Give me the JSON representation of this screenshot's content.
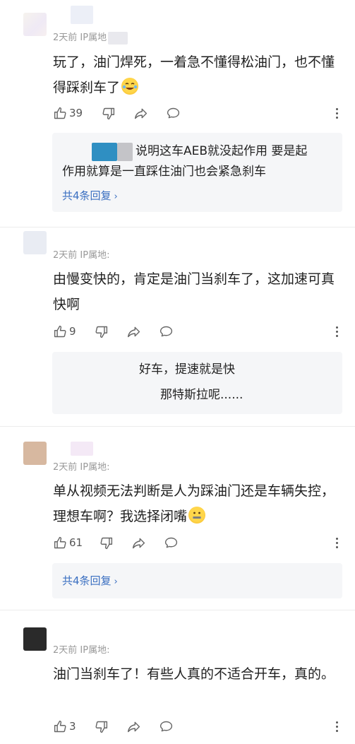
{
  "comments": [
    {
      "meta": "2天前 IP属地",
      "text": "玩了，油门焊死，一着急不懂得松油门，也不懂得踩刹车了",
      "emoji": "laughing-crying-emoji",
      "likes": "39",
      "reply": {
        "line1": "说明这车AEB就没起作用 要是起",
        "line2": "作用就算是一直踩住油门也会紧急刹车",
        "count": "共4条回复"
      }
    },
    {
      "meta": "2天前 IP属地:",
      "text": "由慢变快的，肯定是油门当刹车了，这加速可真快啊",
      "likes": "9",
      "reply": {
        "line1": "好车，提速就是快",
        "line2": "那特斯拉呢......"
      }
    },
    {
      "meta": "2天前 IP属地:",
      "text": "单从视频无法判断是人为踩油门还是车辆失控，理想车啊？我选择闭嘴",
      "emoji": "zipper-mouth-emoji",
      "likes": "61",
      "reply": {
        "count": "共4条回复"
      }
    },
    {
      "meta": "2天前 IP属地:",
      "text": "油门当刹车了！有些人真的不适合开车，真的。",
      "likes": "3"
    }
  ],
  "colors": {
    "link": "#3a6fc1",
    "meta": "#999999",
    "reply_bg": "#f5f6f8"
  }
}
